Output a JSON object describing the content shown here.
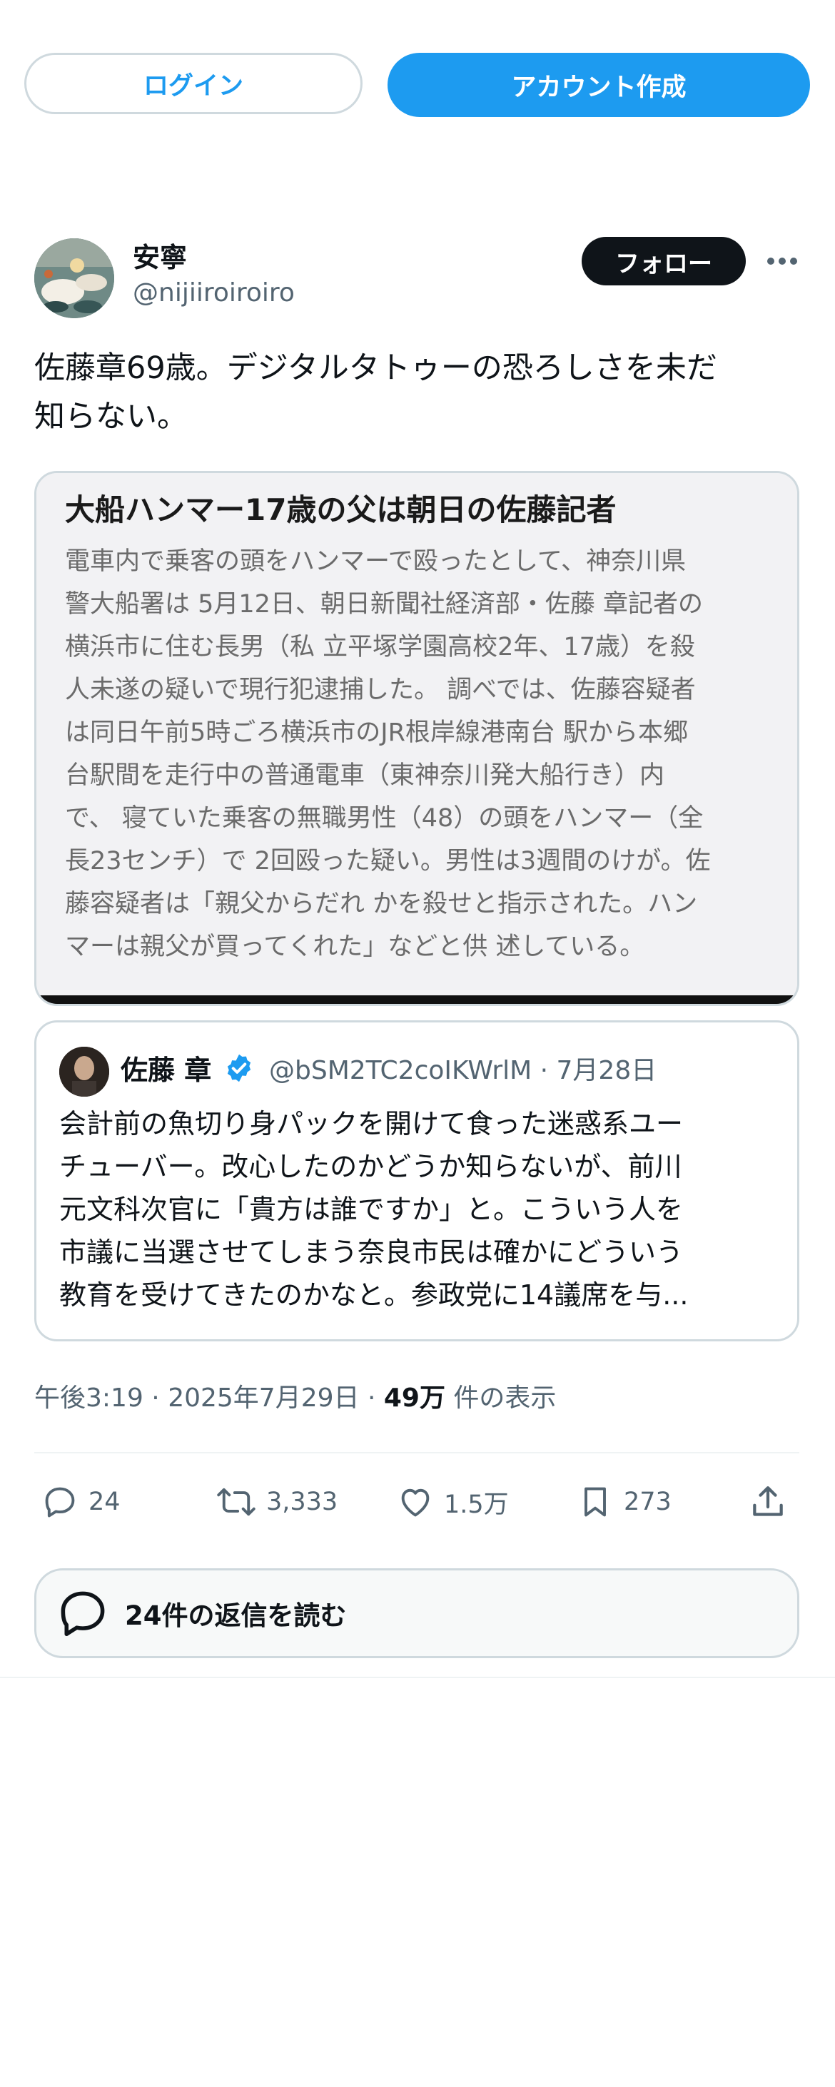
{
  "top_bar": {
    "login_label": "ログイン",
    "signup_label": "アカウント作成"
  },
  "author": {
    "display_name": "安寧",
    "handle": "@nijiiroiroiro",
    "follow_label": "フォロー",
    "more_icon": "more-horizontal-icon"
  },
  "tweet": {
    "text": "佐藤章69歳。デジタルタトゥーの恐ろしさを未だ\n知らない。"
  },
  "media": {
    "headline": "大船ハンマー17歳の父は朝日の佐藤記者",
    "body_lines": [
      "電車内で乗客の頭をハンマーで殴ったとして、神奈川県",
      "警大船署は 5月12日、朝日新聞社経済部・佐藤 章記者の",
      "横浜市に住む長男（私 立平塚学園高校2年、17歳）を殺",
      "人未遂の疑いで現行犯逮捕した。 調べでは、佐藤容疑者",
      "は同日午前5時ごろ横浜市のJR根岸線港南台 駅から本郷",
      "台駅間を走行中の普通電車（東神奈川発大船行き）内",
      "で、 寝ていた乗客の無職男性（48）の頭をハンマー（全",
      "長23センチ）で 2回殴った疑い。男性は3週間のけが。佐",
      "藤容疑者は「親父からだれ かを殺せと指示された。ハン",
      "マーは親父が買ってくれた」などと供 述している。"
    ]
  },
  "quote": {
    "name": "佐藤 章",
    "verified_icon": "verified-badge-icon",
    "handle_date": "@bSM2TC2coIKWrlM · 7月28日",
    "text_lines": [
      "会計前の魚切り身パックを開けて食った迷惑系ユー",
      "チューバー。改心したのかどうか知らないが、前川",
      "元文科次官に「貴方は誰ですか」と。こういう人を",
      "市議に当選させてしまう奈良市民は確かにどういう",
      "教育を受けてきたのかなと。参政党に14議席を与..."
    ]
  },
  "meta": {
    "time": "午後3:19",
    "sep1": " · ",
    "date": "2025年7月29日",
    "sep2": " · ",
    "views_count": "49万",
    "views_label": " 件の表示"
  },
  "actions": {
    "replies": "24",
    "retweets": "3,333",
    "likes": "1.5万",
    "bookmarks": "273"
  },
  "replies_button": {
    "label": "24件の返信を読む"
  },
  "colors": {
    "accent": "#1d9bf0",
    "text_primary": "#0f1419",
    "text_secondary": "#536471",
    "border": "#cfd9de"
  }
}
